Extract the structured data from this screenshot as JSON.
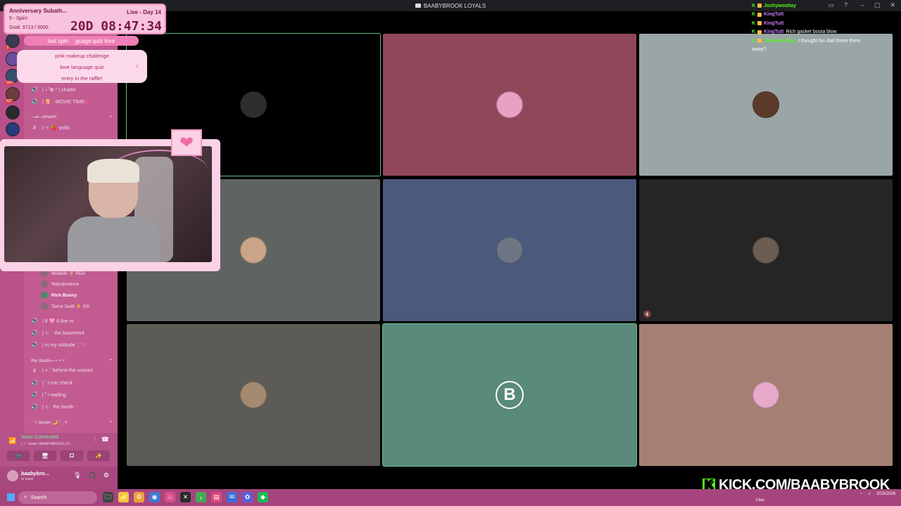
{
  "window": {
    "title": "BAABYBROOK LOYALS"
  },
  "goal_card": {
    "title": "Anniversary Subath...",
    "subtitle": "5 - Spin!",
    "goal": "Goal: 3713 / 5000",
    "live": "Live - Day 14",
    "timer": "20D  08:47:34"
  },
  "spin_bar": {
    "left": "last spin",
    "right": "guage quiz love"
  },
  "bubble": {
    "lines": [
      "pink makeup challenge",
      "love language quiz",
      "entry in the raffle!"
    ],
    "arrow": "‹"
  },
  "sidebar": {
    "servers": [
      {
        "badge": "3"
      },
      {
        "badge": ""
      },
      {
        "badge": "1K+"
      },
      {
        "badge": "427"
      },
      {
        "badge": ""
      },
      {
        "badge": ""
      }
    ],
    "channels_top": [
      {
        "icon": "🔊",
        "label": "| ⋆˚✿˖° | chattin"
      },
      {
        "icon": "🔊",
        "label": "| 🍿 · MOVIE TIME💕"
      }
    ],
    "cat_stream": "—ɞ—stream",
    "channels_stream": [
      {
        "icon": "#",
        "label": "| ✧ 🍓 -polls"
      }
    ],
    "members": [
      {
        "name": "Modello 🌷 RDA",
        "bold": false
      },
      {
        "name": "Nopulpnature",
        "bold": false
      },
      {
        "name": "Rich Bunny",
        "bold": true
      },
      {
        "name": "Terror Swift ⚡ GS",
        "bold": false
      }
    ],
    "channels_mid": [
      {
        "icon": "🔊",
        "label": "| 8 🩷 8 live vc"
      },
      {
        "icon": "🔊",
        "label": "| ⊹ ִ ˑ the basement"
      },
      {
        "icon": "🔊",
        "label": "| in my solitude ʾ,ʾ♡ ˑ"
      }
    ],
    "cat_studio": "the studio—⋆⋆ ˅",
    "channels_studio": [
      {
        "icon": "#",
        "label": "| ⟡.˚ behind-the-scenes"
      },
      {
        "icon": "🔊",
        "label": "| ˚✧mic check"
      },
      {
        "icon": "🔊",
        "label": "| ˚✧waiting"
      },
      {
        "icon": "🔊",
        "label": "| ⊹ ˑ the booth ˑ"
      }
    ],
    "cat_lockin": "˚ ✧ lockin 🌙 ˚·˳ ˅"
  },
  "voice_panel": {
    "title": "Voice Connected",
    "subtitle": "| ⊹˚ chats / BAABYBROOK LO...",
    "buttons": [
      "📹",
      "🖥",
      "⚃",
      "✨"
    ]
  },
  "user_bar": {
    "name": "baabybro...",
    "status": "In voice"
  },
  "participants": [
    {
      "bg": "#000000",
      "avatar": "#2e2e2e",
      "speaking": true,
      "mute": false
    },
    {
      "bg": "#91475a",
      "avatar": "#e6a1c3",
      "speaking": false,
      "mute": false
    },
    {
      "bg": "#9aa5a6",
      "avatar": "#5b3a2a",
      "speaking": false,
      "mute": false
    },
    {
      "bg": "#5f6463",
      "avatar": "#c9a486",
      "speaking": false,
      "mute": false
    },
    {
      "bg": "#4b5a7c",
      "avatar": "#6e7584",
      "speaking": false,
      "mute": false
    },
    {
      "bg": "#252525",
      "avatar": "#6b5d52",
      "speaking": false,
      "mute": true
    },
    {
      "bg": "#5c5b55",
      "avatar": "#a48a70",
      "speaking": false,
      "mute": false
    },
    {
      "bg": "#5a8a7a",
      "avatar": "#5a8a7a",
      "speaking": true,
      "mute": false,
      "letter": "B"
    },
    {
      "bg": "#a67f74",
      "avatar": "#e7a9c9",
      "speaking": false,
      "mute": false
    }
  ],
  "chat": [
    {
      "user": "Joshywoshay",
      "color": "n1",
      "text": ""
    },
    {
      "user": "KingTutt",
      "color": "n2",
      "text": ""
    },
    {
      "user": "KingTutt",
      "color": "n2",
      "text": ""
    },
    {
      "user": "KingTutt",
      "color": "n2",
      "text": "Rich gasket bouta blow"
    },
    {
      "user": "Joshywoshay",
      "color": "n1",
      "text": "I thought his dad threw them"
    },
    {
      "user": "",
      "color": "n1",
      "text": "away?"
    }
  ],
  "kick_banner": {
    "text": "KICK.COM/BAABYBROOK",
    "logo": "K"
  },
  "taskbar": {
    "search": "Search",
    "apps": [
      "🗀",
      "📁",
      "⚙",
      "◉",
      "♨",
      "✕",
      "♪",
      "▤",
      "✉",
      "✿",
      "◆"
    ],
    "clear": "Clear",
    "date": "2/15/2026"
  }
}
